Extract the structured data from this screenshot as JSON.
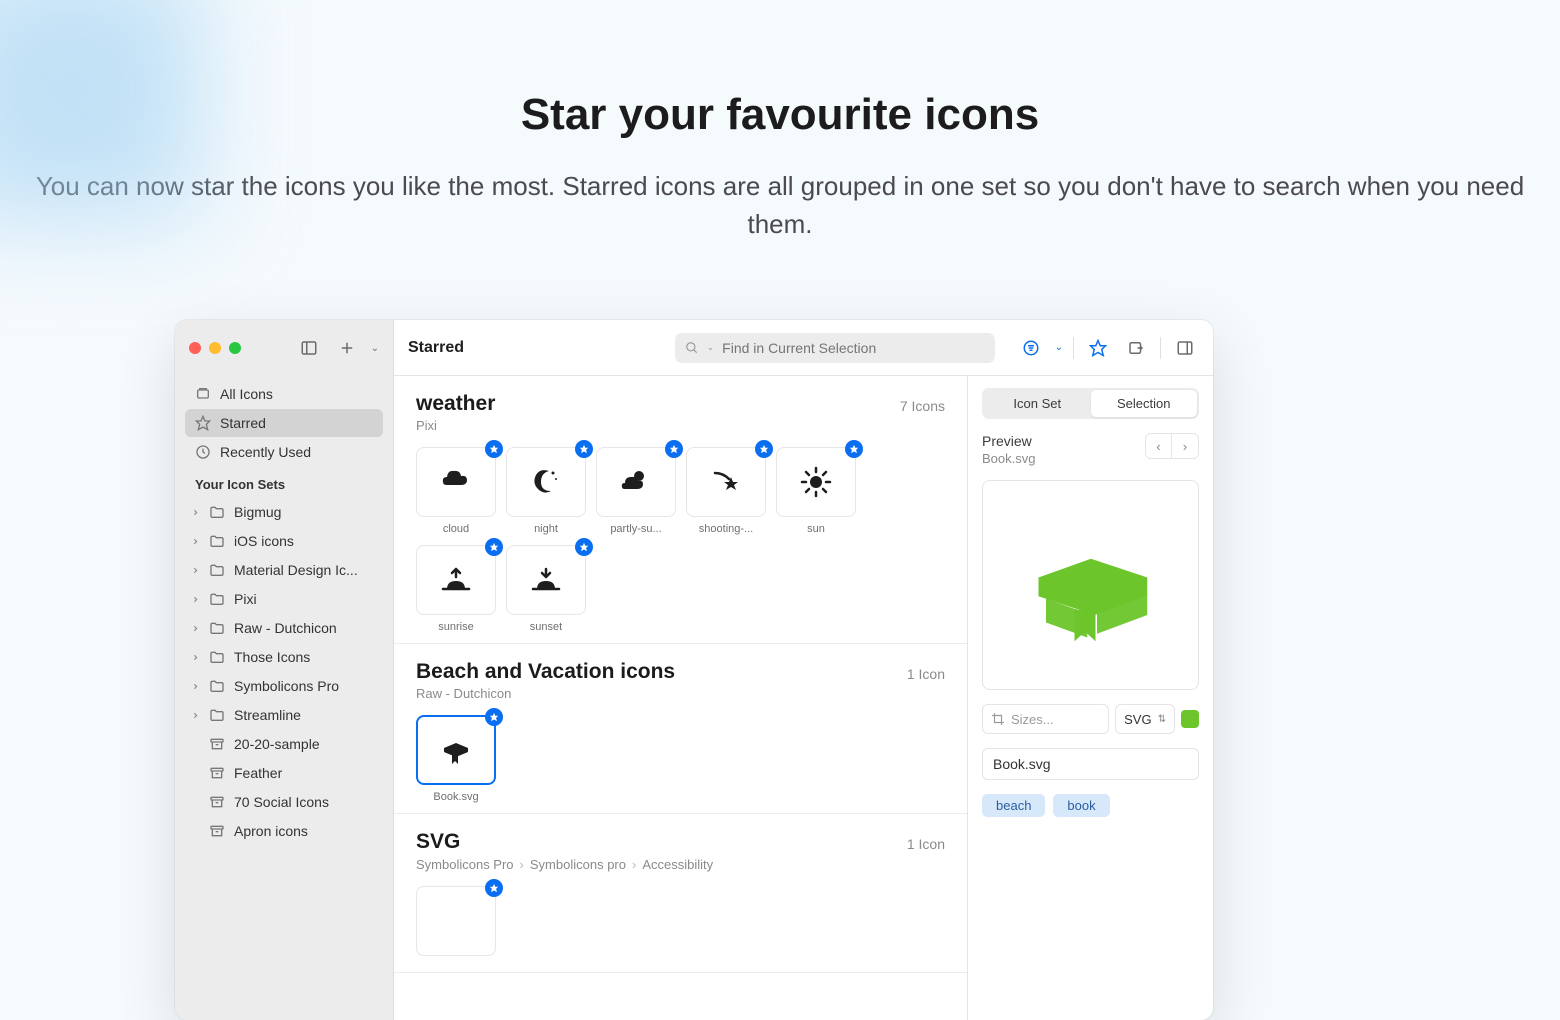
{
  "page": {
    "headline": "Star your favourite icons",
    "sub": "You can now star the icons you like the most. Starred icons are all grouped in one set so you don't have to search when you need them."
  },
  "sidebar": {
    "smart": [
      {
        "label": "All Icons",
        "icon": "stack"
      },
      {
        "label": "Starred",
        "icon": "star",
        "active": true
      },
      {
        "label": "Recently Used",
        "icon": "clock"
      }
    ],
    "header": "Your Icon Sets",
    "sets": [
      {
        "label": "Bigmug",
        "expandable": true
      },
      {
        "label": "iOS icons",
        "expandable": true
      },
      {
        "label": "Material Design Ic...",
        "expandable": true
      },
      {
        "label": "Pixi",
        "expandable": true
      },
      {
        "label": "Raw - Dutchicon",
        "expandable": true
      },
      {
        "label": "Those Icons",
        "expandable": true
      },
      {
        "label": "Symbolicons Pro",
        "expandable": true
      },
      {
        "label": "Streamline",
        "expandable": true
      },
      {
        "label": "20-20-sample",
        "expandable": false
      },
      {
        "label": "Feather",
        "expandable": false
      },
      {
        "label": "70 Social Icons",
        "expandable": false
      },
      {
        "label": "Apron icons",
        "expandable": false
      }
    ]
  },
  "toolbar": {
    "title": "Starred",
    "search_placeholder": "Find in Current Selection"
  },
  "sections": [
    {
      "title": "weather",
      "source": "Pixi",
      "count": "7 Icons",
      "icons": [
        {
          "name": "cloud",
          "shape": "cloud"
        },
        {
          "name": "night",
          "shape": "night"
        },
        {
          "name": "partly-su...",
          "shape": "partly"
        },
        {
          "name": "shooting-...",
          "shape": "shooting"
        },
        {
          "name": "sun",
          "shape": "sun"
        },
        {
          "name": "sunrise",
          "shape": "sunrise"
        },
        {
          "name": "sunset",
          "shape": "sunset"
        }
      ]
    },
    {
      "title": "Beach and Vacation icons",
      "source": "Raw - Dutchicon",
      "count": "1 Icon",
      "icons": [
        {
          "name": "Book.svg",
          "shape": "book",
          "selected": true
        }
      ]
    },
    {
      "title": "SVG",
      "breadcrumb": [
        "Symbolicons Pro",
        "Symbolicons pro",
        "Accessibility"
      ],
      "count": "1 Icon",
      "icons": [
        {
          "name": "",
          "shape": "placeholder"
        }
      ]
    }
  ],
  "inspector": {
    "tabs": [
      "Icon Set",
      "Selection"
    ],
    "active_tab": "Selection",
    "preview_label": "Preview",
    "filename": "Book.svg",
    "sizes_placeholder": "Sizes...",
    "format": "SVG",
    "swatch_color": "#6bc52b",
    "name_value": "Book.svg",
    "tags": [
      "beach",
      "book"
    ]
  }
}
